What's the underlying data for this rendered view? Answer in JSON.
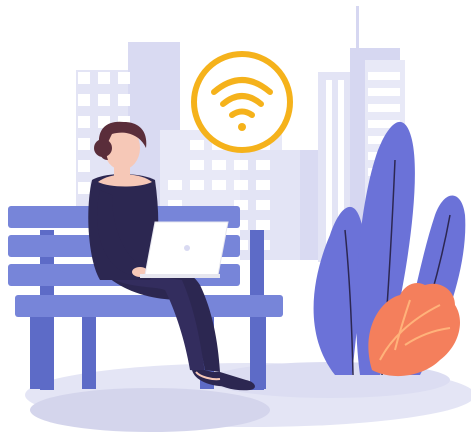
{
  "illustration": {
    "icons": {
      "wifi": "wifi-icon"
    },
    "colors": {
      "background": "#ffffff",
      "building_light": "#e5e6f6",
      "building_mid": "#d6d7f1",
      "window": "#ffffff",
      "bench": "#7785d9",
      "bench_dark": "#5d6bc7",
      "plant_blue": "#6b72d8",
      "plant_orange": "#f47f5c",
      "plant_orange_light": "#ffb27a",
      "ground_shadow": "#dedff3",
      "ground_shadow_dark": "#cdcee9",
      "wifi_ring": "#f5b21b",
      "person_dark": "#2c2751",
      "hair": "#5a2d3a",
      "skin": "#f6c8b7",
      "laptop": "#ffffff",
      "shoe": "#2c2751"
    }
  }
}
